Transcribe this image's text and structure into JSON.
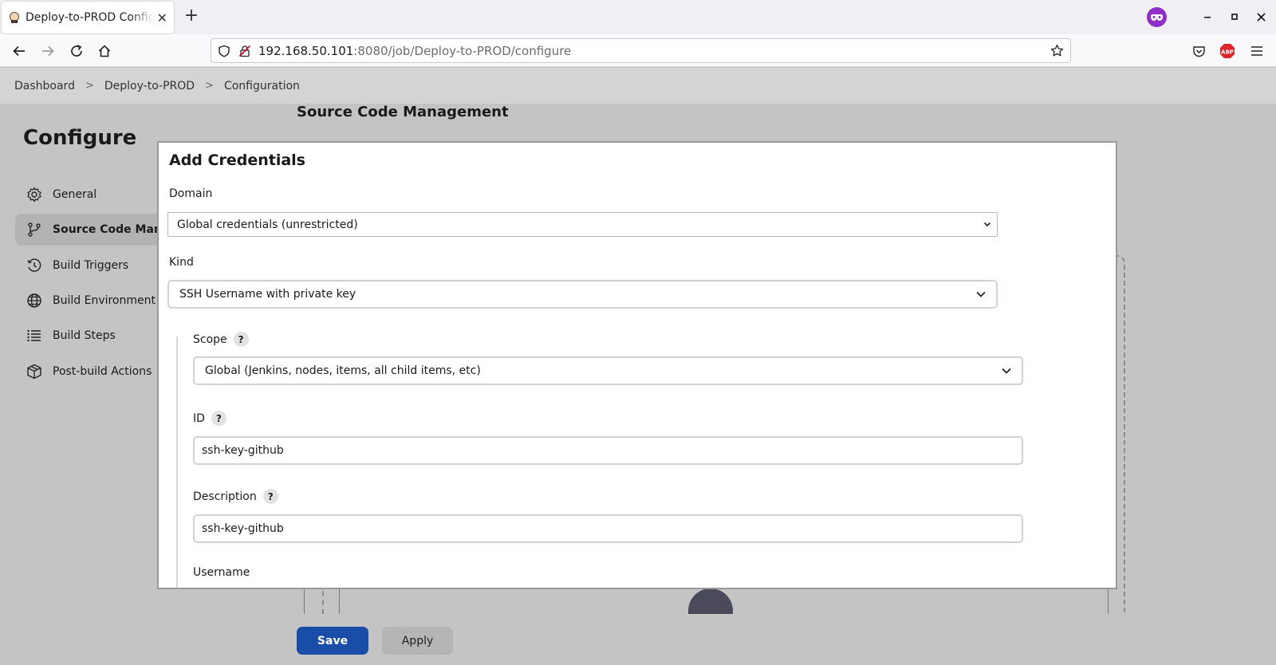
{
  "browser": {
    "tab_title": "Deploy-to-PROD Config [Jenkins]",
    "url_host": "192.168.50.101",
    "url_rest": ":8080/job/Deploy-to-PROD/configure"
  },
  "breadcrumb": {
    "items": [
      "Dashboard",
      "Deploy-to-PROD",
      "Configuration"
    ],
    "separator": ">"
  },
  "page": {
    "title": "Configure",
    "section_heading": "Source Code Management"
  },
  "sidebar": {
    "items": [
      {
        "label": "General",
        "icon": "gear-icon"
      },
      {
        "label": "Source Code Management",
        "icon": "branch-icon",
        "active": true
      },
      {
        "label": "Build Triggers",
        "icon": "clock-icon"
      },
      {
        "label": "Build Environment",
        "icon": "globe-icon"
      },
      {
        "label": "Build Steps",
        "icon": "list-icon"
      },
      {
        "label": "Post-build Actions",
        "icon": "box-icon"
      }
    ]
  },
  "dialog": {
    "title": "Add Credentials",
    "domain": {
      "label": "Domain",
      "value": "Global credentials (unrestricted)"
    },
    "kind": {
      "label": "Kind",
      "value": "SSH Username with private key"
    },
    "scope": {
      "label": "Scope",
      "value": "Global (Jenkins, nodes, items, all child items, etc)",
      "help": "?"
    },
    "id": {
      "label": "ID",
      "value": "ssh-key-github",
      "help": "?"
    },
    "description": {
      "label": "Description",
      "value": "ssh-key-github",
      "help": "?"
    },
    "username": {
      "label": "Username"
    }
  },
  "footer": {
    "save_label": "Save",
    "apply_label": "Apply"
  },
  "colors": {
    "primary_button": "#1a4da8",
    "private_badge": "#8f2ecb"
  }
}
